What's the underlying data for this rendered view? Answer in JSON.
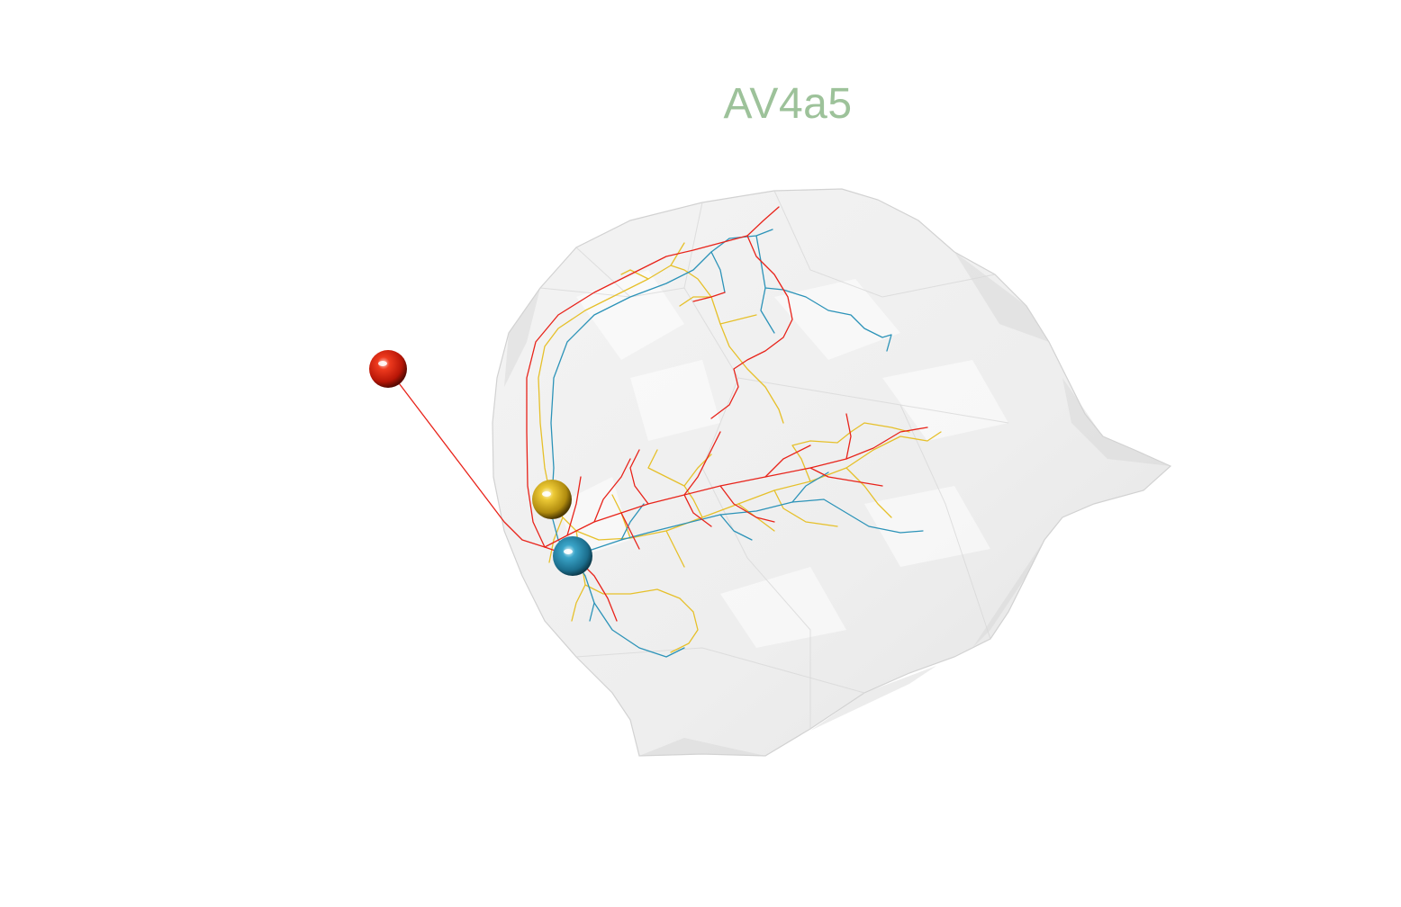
{
  "title": "AV4a5",
  "colors": {
    "title": "#9dc29a",
    "neuropil": "#e6e6e6",
    "red": "#e8231a",
    "yellow": "#e6c02a",
    "blue": "#2c93b8"
  },
  "neurons": [
    {
      "name": "red-neuron",
      "color": "#e8231a"
    },
    {
      "name": "yellow-neuron",
      "color": "#e6c02a"
    },
    {
      "name": "blue-neuron",
      "color": "#2c93b8"
    }
  ]
}
